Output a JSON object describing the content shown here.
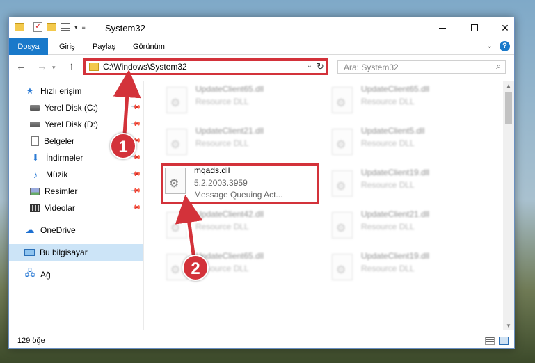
{
  "window": {
    "title": "System32"
  },
  "ribbon": {
    "tabs": [
      "Dosya",
      "Giriş",
      "Paylaş",
      "Görünüm"
    ],
    "help": "?"
  },
  "nav": {
    "address": "C:\\Windows\\System32",
    "search_placeholder": "Ara: System32"
  },
  "sidebar": {
    "items": [
      {
        "label": "Hızlı erişim",
        "icon": "star-icon"
      },
      {
        "label": "Yerel Disk (C:)",
        "icon": "drive-icon"
      },
      {
        "label": "Yerel Disk (D:)",
        "icon": "drive-icon"
      },
      {
        "label": "Belgeler",
        "icon": "document-icon"
      },
      {
        "label": "İndirmeler",
        "icon": "download-icon"
      },
      {
        "label": "Müzik",
        "icon": "music-icon"
      },
      {
        "label": "Resimler",
        "icon": "pictures-icon"
      },
      {
        "label": "Videolar",
        "icon": "video-icon"
      },
      {
        "label": "OneDrive",
        "icon": "cloud-icon"
      },
      {
        "label": "Bu bilgisayar",
        "icon": "computer-icon"
      },
      {
        "label": "Ağ",
        "icon": "network-icon"
      }
    ]
  },
  "files": [
    {
      "name": "UpdateClient65.dll",
      "l2": "Resource DLL",
      "l3": ""
    },
    {
      "name": "UpdateClient65.dll",
      "l2": "Resource DLL",
      "l3": ""
    },
    {
      "name": "UpdateClient21.dll",
      "l2": "Resource DLL",
      "l3": ""
    },
    {
      "name": "UpdateClient5.dll",
      "l2": "Resource DLL",
      "l3": ""
    },
    {
      "name": "mqads.dll",
      "l2": "5.2.2003.3959",
      "l3": "Message Queuing Act..."
    },
    {
      "name": "UpdateClient19.dll",
      "l2": "Resource DLL",
      "l3": ""
    },
    {
      "name": "UpdateClient42.dll",
      "l2": "Resource DLL",
      "l3": ""
    },
    {
      "name": "UpdateClient21.dll",
      "l2": "Resource DLL",
      "l3": ""
    },
    {
      "name": "UpdateClient65.dll",
      "l2": "Resource DLL",
      "l3": ""
    },
    {
      "name": "UpdateClient19.dll",
      "l2": "Resource DLL",
      "l3": ""
    }
  ],
  "status": {
    "count": "129 öğe"
  },
  "annotations": {
    "badge1": "1",
    "badge2": "2",
    "color": "#d3323a"
  }
}
